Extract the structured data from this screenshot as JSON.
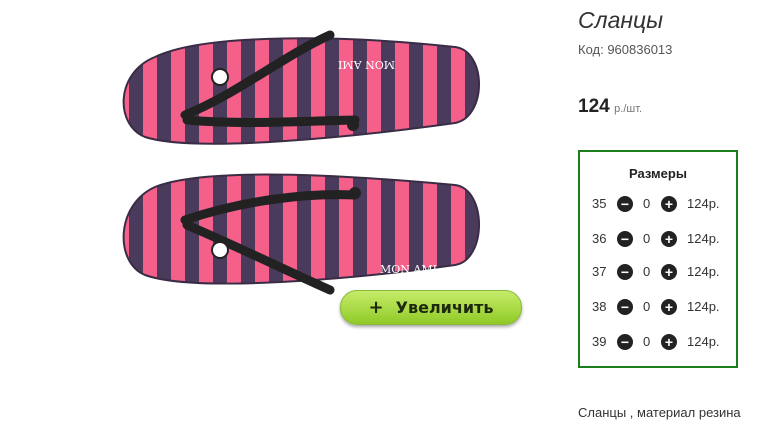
{
  "product": {
    "title": "Сланцы",
    "code": "Код: 960836013",
    "price": "124",
    "price_unit": "р./шт.",
    "zoom_label": "Увеличить",
    "zoom_plus": "+",
    "description": "Сланцы , материал резина",
    "brand_print": "MON AMI"
  },
  "sizes": {
    "title": "Размеры",
    "rows": [
      {
        "size": "35",
        "qty": "0",
        "price": "124р."
      },
      {
        "size": "36",
        "qty": "0",
        "price": "124р."
      },
      {
        "size": "37",
        "qty": "0",
        "price": "124р."
      },
      {
        "size": "38",
        "qty": "0",
        "price": "124р."
      },
      {
        "size": "39",
        "qty": "0",
        "price": "124р."
      }
    ]
  },
  "colors": {
    "frame": "#1a7f1a",
    "stripe_pink": "#f5608a",
    "stripe_dark": "#4a3b5c",
    "button_green": "#a7dc3c"
  }
}
